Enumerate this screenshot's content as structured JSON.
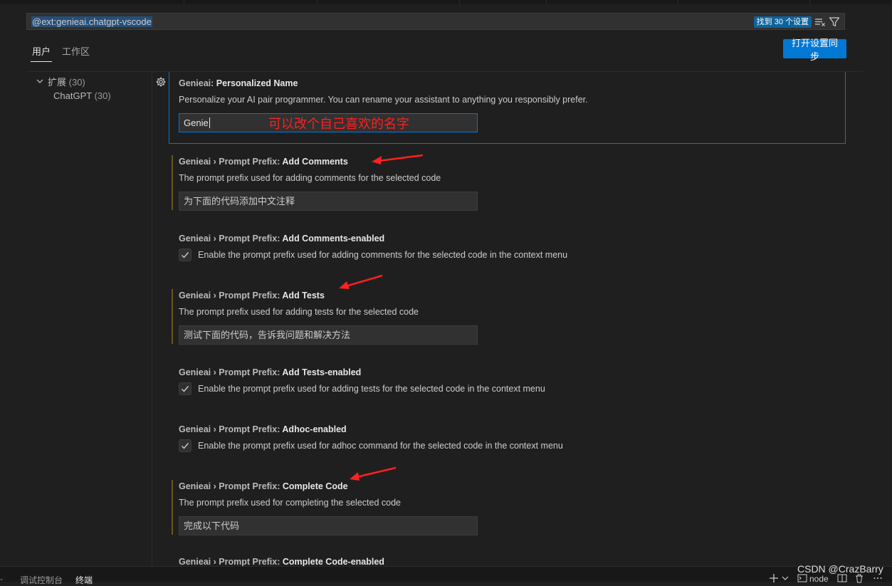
{
  "search": {
    "query": "@ext:genieai.chatgpt-vscode",
    "result_badge": "找到 30 个设置"
  },
  "tabs": [
    {
      "label": "用户",
      "selected": true
    },
    {
      "label": "工作区",
      "selected": false
    }
  ],
  "sync_button_label": "打开设置同步",
  "toc": {
    "extensions": {
      "label": "扩展",
      "count": "(30)"
    },
    "chatgpt": {
      "label": "ChatGPT",
      "count": "(30)"
    }
  },
  "settings": [
    {
      "category": "Genieai: ",
      "name": "Personalized Name",
      "description": "Personalize your AI pair programmer. You can rename your assistant to anything you responsibly prefer.",
      "value": "Genie"
    },
    {
      "category": "Genieai › Prompt Prefix: ",
      "name": "Add Comments",
      "description": "The prompt prefix used for adding comments for the selected code",
      "value": "为下面的代码添加中文注释"
    },
    {
      "category": "Genieai › Prompt Prefix: ",
      "name": "Add Comments-enabled",
      "description": "Enable the prompt prefix used for adding comments for the selected code in the context menu",
      "checked": true
    },
    {
      "category": "Genieai › Prompt Prefix: ",
      "name": "Add Tests",
      "description": "The prompt prefix used for adding tests for the selected code",
      "value": "测试下面的代码，告诉我问题和解决方法"
    },
    {
      "category": "Genieai › Prompt Prefix: ",
      "name": "Add Tests-enabled",
      "description": "Enable the prompt prefix used for adding tests for the selected code in the context menu",
      "checked": true
    },
    {
      "category": "Genieai › Prompt Prefix: ",
      "name": "Adhoc-enabled",
      "description": "Enable the prompt prefix used for adhoc command for the selected code in the context menu",
      "checked": true
    },
    {
      "category": "Genieai › Prompt Prefix: ",
      "name": "Complete Code",
      "description": "The prompt prefix used for completing the selected code",
      "value": "完成以下代码"
    },
    {
      "category": "Genieai › Prompt Prefix: ",
      "name": "Complete Code-enabled"
    }
  ],
  "annotation": "可以改个自己喜欢的名字",
  "panel": {
    "tab_left": "-",
    "tab_debug": "调试控制台",
    "tab_terminal": "终端",
    "terminal_name": "node"
  },
  "watermark": "CSDN @CrazBarry",
  "colors": {
    "accent": "#0078d4",
    "annotation_red": "#ff2020",
    "modified_bar": "#6b5520"
  }
}
